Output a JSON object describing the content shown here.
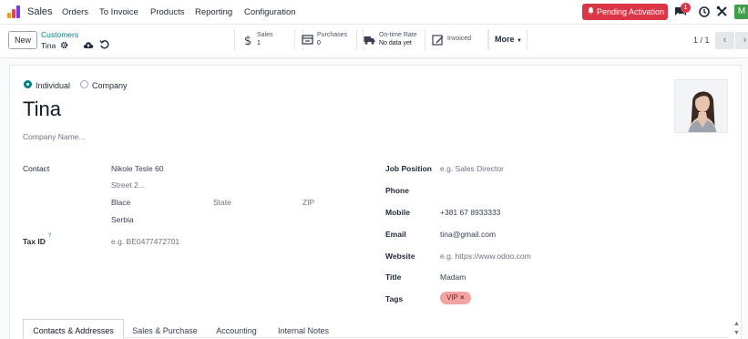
{
  "navbar": {
    "app_name": "Sales",
    "menu": [
      "Orders",
      "To Invoice",
      "Products",
      "Reporting",
      "Configuration"
    ],
    "pending_label": "Pending Activation",
    "chat_badge": "1",
    "user_initial": "M",
    "logo_colors": [
      "#f59e0b",
      "#ef4444",
      "#7c3aed"
    ]
  },
  "control": {
    "new_label": "New",
    "breadcrumb_parent": "Customers",
    "breadcrumb_current": "Tina",
    "smart_buttons": [
      {
        "icon": "dollar-icon",
        "title": "Sales",
        "value": "1"
      },
      {
        "icon": "purchases-icon",
        "title": "Purchases",
        "value": "0"
      },
      {
        "icon": "truck-icon",
        "title": "On-time Rate",
        "value": "No data yet"
      },
      {
        "icon": "edit-icon",
        "title": "Invoiced",
        "value": ""
      }
    ],
    "more_label": "More",
    "pager": "1 / 1"
  },
  "form": {
    "type_individual": "Individual",
    "type_company": "Company",
    "name": "Tina",
    "company_placeholder": "Company Name...",
    "contact_label": "Contact",
    "street": "Nikole Tesle 60",
    "street2_placeholder": "Street 2...",
    "city": "Blace",
    "state_placeholder": "State",
    "zip_placeholder": "ZIP",
    "country": "Serbia",
    "tax_label": "Tax ID",
    "tax_help": "?",
    "tax_placeholder": "e.g. BE0477472701",
    "job_label": "Job Position",
    "job_placeholder": "e.g. Sales Director",
    "phone_label": "Phone",
    "mobile_label": "Mobile",
    "mobile": "+381 67 8933333",
    "email_label": "Email",
    "email": "tina@gmail.com",
    "website_label": "Website",
    "website_placeholder": "e.g. https://www.odoo.com",
    "title_label": "Title",
    "title": "Madam",
    "tags_label": "Tags",
    "tag": "VIP"
  },
  "tabs": [
    "Contacts & Addresses",
    "Sales & Purchase",
    "Accounting",
    "Internal Notes"
  ]
}
